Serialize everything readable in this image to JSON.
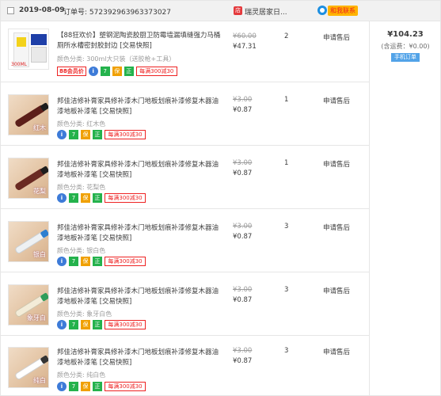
{
  "header": {
    "date": "2019-08-09",
    "order_label": "订单号:",
    "order_no": "572392963963373027",
    "shop_name": "瑞灵居家日...",
    "contact_label": "和我联系"
  },
  "summary": {
    "total": "¥104.23",
    "shipping": "(含运费：¥0.00)",
    "mobile_order": "手机订单"
  },
  "items": [
    {
      "title": "【88狂欢价】塑钢泥陶瓷胶厨卫防霉墙漏填缝强力马桶厕所水槽密封胶封边 [交易快照]",
      "sku_label": "颜色分类:",
      "sku": "300ml大只装（送胶枪+工具）",
      "thumb_caption": "300ML",
      "orig_price": "¥60.00",
      "price": "¥47.31",
      "qty": "2",
      "action": "申请售后",
      "tag88": "88会员价",
      "promo": "每满300减30"
    },
    {
      "title": "邦佳洁修补膏家具修补漆木门地板划痕补漆修复木器油漆地板补漆笔 [交易快照]",
      "sku_label": "颜色分类:",
      "sku": "红木色",
      "thumb_caption": "红木",
      "orig_price": "¥3.00",
      "price": "¥0.87",
      "qty": "1",
      "action": "申请售后",
      "promo": "每满300减30",
      "tube_color": "#5c1f1a"
    },
    {
      "title": "邦佳洁修补膏家具修补漆木门地板划痕补漆修复木器油漆地板补漆笔 [交易快照]",
      "sku_label": "颜色分类:",
      "sku": "花梨色",
      "thumb_caption": "花梨",
      "orig_price": "¥3.00",
      "price": "¥0.87",
      "qty": "1",
      "action": "申请售后",
      "promo": "每满300减30",
      "tube_color": "#6a2a22"
    },
    {
      "title": "邦佳洁修补膏家具修补漆木门地板划痕补漆修复木器油漆地板补漆笔 [交易快照]",
      "sku_label": "颜色分类:",
      "sku": "银白色",
      "thumb_caption": "银白",
      "orig_price": "¥3.00",
      "price": "¥0.87",
      "qty": "3",
      "action": "申请售后",
      "promo": "每满300减30",
      "tube_color": "#eef1f3"
    },
    {
      "title": "邦佳洁修补膏家具修补漆木门地板划痕补漆修复木器油漆地板补漆笔 [交易快照]",
      "sku_label": "颜色分类:",
      "sku": "象牙白色",
      "thumb_caption": "象牙白",
      "orig_price": "¥3.00",
      "price": "¥0.87",
      "qty": "3",
      "action": "申请售后",
      "promo": "每满300减30",
      "tube_color": "#f3ecd8"
    },
    {
      "title": "邦佳洁修补膏家具修补漆木门地板划痕补漆修复木器油漆地板补漆笔 [交易快照]",
      "sku_label": "颜色分类:",
      "sku": "纯白色",
      "thumb_caption": "纯白",
      "orig_price": "¥3.00",
      "price": "¥0.87",
      "qty": "3",
      "action": "申请售后",
      "promo": "每满300减30",
      "tube_color": "#ffffff"
    }
  ],
  "colors": {
    "accent_red": "#e22",
    "link_blue": "#52a3e8",
    "header_bg": "#f1f1f1"
  }
}
